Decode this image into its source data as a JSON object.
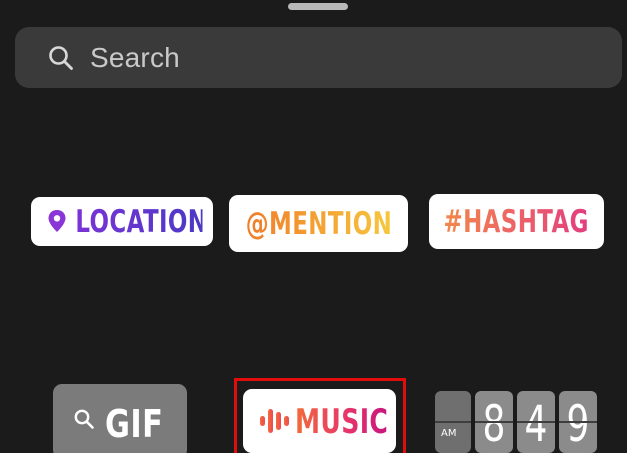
{
  "search": {
    "placeholder": "Search"
  },
  "stickers": {
    "location": {
      "label": "LOCATION",
      "icon": "location-pin-icon",
      "color": "#6a2fd0"
    },
    "mention": {
      "label": "@MENTION",
      "color": "#f39a32"
    },
    "hashtag": {
      "label": "#HASHTAG",
      "color": "#ea6263"
    },
    "gif": {
      "label": "GIF",
      "icon": "search-icon"
    },
    "music": {
      "label": "MUSIC",
      "icon": "music-bars-icon",
      "color": "#e8356a"
    },
    "clock": {
      "ampm": "AM",
      "digits": [
        "8",
        "4",
        "9"
      ]
    }
  },
  "colors": {
    "background": "#1b1b1b",
    "search_bg": "#3a3a3a",
    "highlight": "#e00d0d"
  }
}
